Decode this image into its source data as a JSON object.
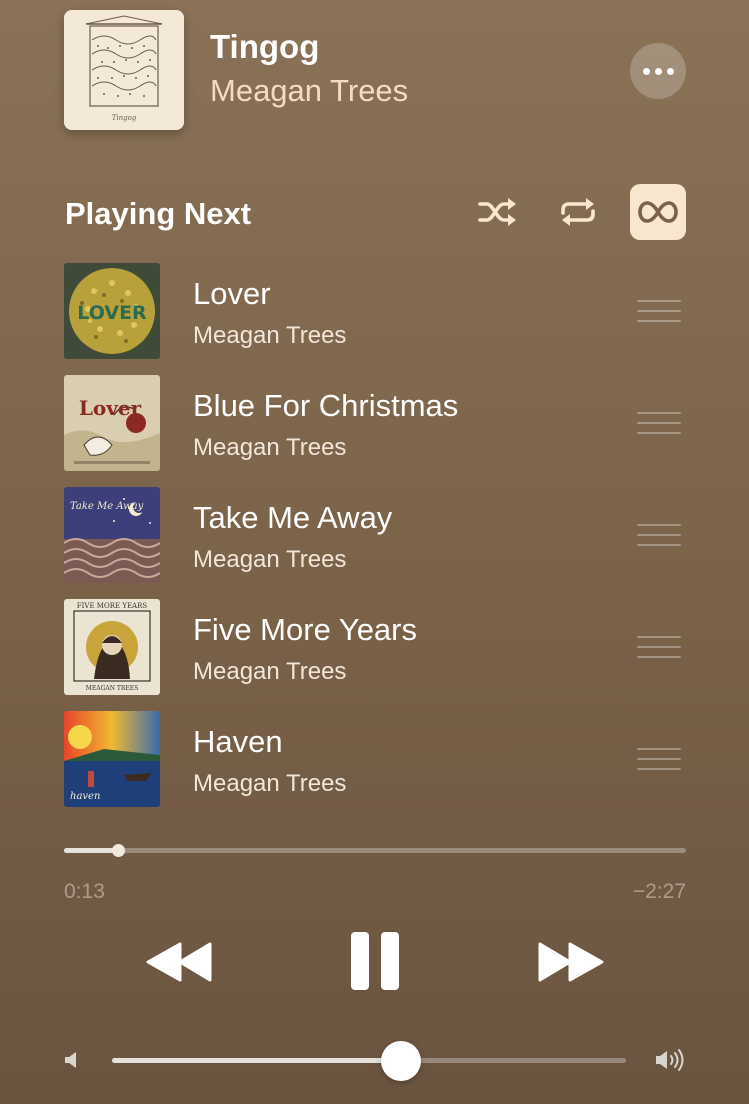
{
  "now_playing": {
    "title": "Tingog",
    "artist": "Meagan Trees",
    "art_text": "Tingog",
    "more_icon": "ellipsis-icon"
  },
  "queue_header": {
    "label": "Playing Next",
    "shuffle_icon": "shuffle-icon",
    "repeat_icon": "repeat-icon",
    "autoplay_icon": "infinity-icon",
    "autoplay_active": true
  },
  "queue": [
    {
      "title": "Lover",
      "artist": "Meagan Trees",
      "art_text": "LOVER"
    },
    {
      "title": "Blue For Christmas",
      "artist": "Meagan Trees",
      "art_text": "Lover"
    },
    {
      "title": "Take Me Away",
      "artist": "Meagan Trees",
      "art_text": "Take Me Away"
    },
    {
      "title": "Five More Years",
      "artist": "Meagan Trees",
      "art_text": "FIVE MORE YEARS",
      "art_subtext": "MEAGAN TREES"
    },
    {
      "title": "Haven",
      "artist": "Meagan Trees",
      "art_text": "haven"
    }
  ],
  "playback": {
    "elapsed": "0:13",
    "remaining": "−2:27",
    "progress_fraction": 0.087,
    "rewind_icon": "rewind-icon",
    "pause_icon": "pause-icon",
    "forward_icon": "fast-forward-icon"
  },
  "volume": {
    "level_fraction": 0.563,
    "low_icon": "speaker-low-icon",
    "high_icon": "speaker-high-icon"
  },
  "colors": {
    "background_top": "#8a7257",
    "background_bottom": "#6a5440",
    "artist_accent": "#f5dcc0",
    "autoplay_active_bg": "#f8e6cf"
  }
}
